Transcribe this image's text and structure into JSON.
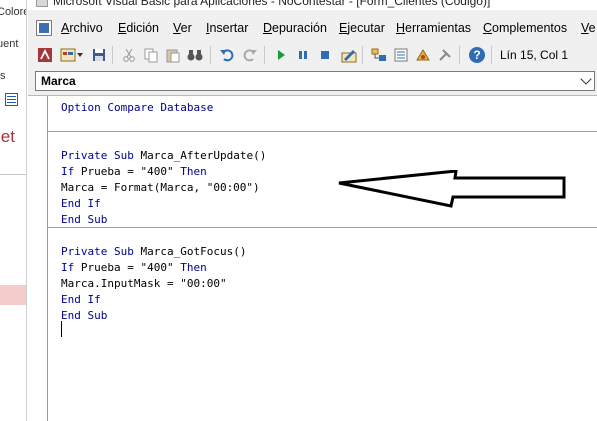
{
  "window": {
    "title": "Microsoft Visual Basic para Aplicaciones - NoContestar - [Form_Clientes (Código)]"
  },
  "background_window": {
    "fragments": [
      "Colore",
      "uent",
      "s"
    ],
    "object_label": "jet"
  },
  "menu": {
    "items": [
      {
        "mnemonic": "A",
        "rest": "rchivo"
      },
      {
        "mnemonic": "E",
        "rest": "dición"
      },
      {
        "mnemonic": "V",
        "rest": "er"
      },
      {
        "mnemonic": "I",
        "rest": "nsertar"
      },
      {
        "mnemonic": "D",
        "rest": "epuración"
      },
      {
        "mnemonic": "E",
        "rest": "jecutar"
      },
      {
        "mnemonic": "H",
        "rest": "erramientas"
      },
      {
        "mnemonic": "C",
        "rest": "omplementos"
      },
      {
        "mnemonic": "V",
        "rest": "e"
      }
    ]
  },
  "toolbar": {
    "status": "Lín 15, Col 1"
  },
  "combo": {
    "selected": "Marca"
  },
  "code": {
    "lines": [
      [
        {
          "t": "Option Compare Database",
          "k": true
        }
      ],
      [],
      [],
      [
        {
          "t": "Private Sub ",
          "k": true
        },
        {
          "t": "Marca_AfterUpdate()",
          "k": false
        }
      ],
      [
        {
          "t": "If ",
          "k": true
        },
        {
          "t": "Prueba = \"400\" ",
          "k": false
        },
        {
          "t": "Then",
          "k": true
        }
      ],
      [
        {
          "t": "Marca = Format(Marca, \"00:00\")",
          "k": false
        }
      ],
      [
        {
          "t": "End If",
          "k": true
        }
      ],
      [
        {
          "t": "End Sub",
          "k": true
        }
      ],
      [],
      [
        {
          "t": "Private Sub ",
          "k": true
        },
        {
          "t": "Marca_GotFocus()",
          "k": false
        }
      ],
      [
        {
          "t": "If ",
          "k": true
        },
        {
          "t": "Prueba = \"400\" ",
          "k": false
        },
        {
          "t": "Then",
          "k": true
        }
      ],
      [
        {
          "t": "Marca.InputMask = \"00:00\"",
          "k": false
        }
      ],
      [
        {
          "t": "End If",
          "k": true
        }
      ],
      [
        {
          "t": "End Sub",
          "k": true
        }
      ],
      []
    ]
  },
  "colors": {
    "keyword": "#00008b",
    "accent_red": "#a4373a"
  }
}
